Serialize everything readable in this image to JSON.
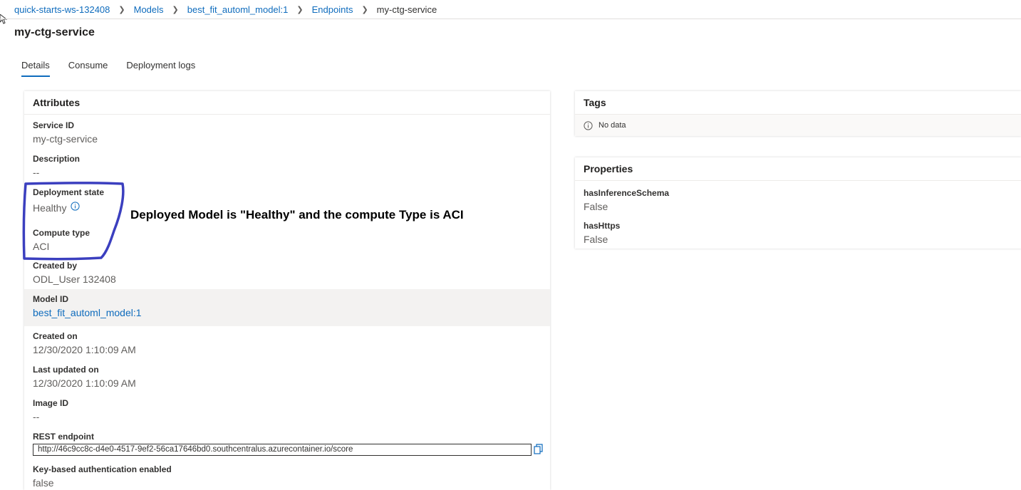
{
  "breadcrumb": {
    "items": [
      "quick-starts-ws-132408",
      "Models",
      "best_fit_automl_model:1",
      "Endpoints"
    ],
    "current": "my-ctg-service"
  },
  "page_title": "my-ctg-service",
  "tabs": [
    "Details",
    "Consume",
    "Deployment logs"
  ],
  "attributes": {
    "header": "Attributes",
    "service_id_label": "Service ID",
    "service_id": "my-ctg-service",
    "description_label": "Description",
    "description": "--",
    "deployment_state_label": "Deployment state",
    "deployment_state": "Healthy",
    "compute_type_label": "Compute type",
    "compute_type": "ACI",
    "created_by_label": "Created by",
    "created_by": "ODL_User 132408",
    "model_id_label": "Model ID",
    "model_id": "best_fit_automl_model:1",
    "created_on_label": "Created on",
    "created_on": "12/30/2020 1:10:09 AM",
    "last_updated_label": "Last updated on",
    "last_updated": "12/30/2020 1:10:09 AM",
    "image_id_label": "Image ID",
    "image_id": "--",
    "rest_endpoint_label": "REST endpoint",
    "rest_endpoint": "http://46c9cc8c-d4e0-4517-9ef2-56ca17646bd0.southcentralus.azurecontainer.io/score",
    "key_auth_label": "Key-based authentication enabled",
    "key_auth": "false"
  },
  "tags": {
    "header": "Tags",
    "empty_text": "No data"
  },
  "properties": {
    "header": "Properties",
    "items": [
      {
        "label": "hasInferenceSchema",
        "value": "False"
      },
      {
        "label": "hasHttps",
        "value": "False"
      }
    ]
  },
  "annotation": {
    "text": "Deployed Model is \"Healthy\" and the compute Type is ACI",
    "color": "#3b3fbf"
  },
  "colors": {
    "link": "#0f6cbd",
    "accent": "#0f6cbd"
  }
}
